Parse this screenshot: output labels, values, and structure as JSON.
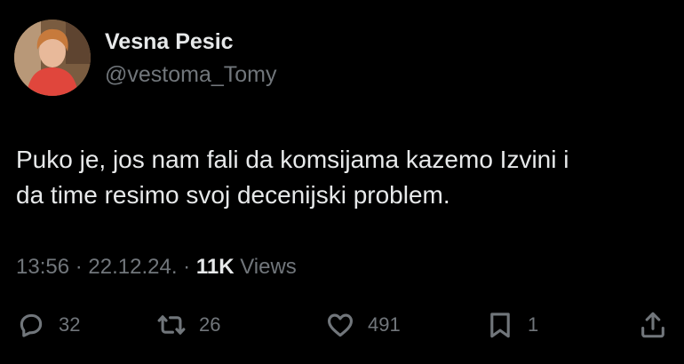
{
  "author": {
    "name": "Vesna Pesic",
    "handle": "@vestoma_Tomy"
  },
  "tweet": {
    "lines": [
      "Puko je, jos nam fali da komsijama kazemo Izvini i",
      "da time resimo svoj decenijski problem."
    ]
  },
  "meta": {
    "time": "13:56",
    "separator": "·",
    "date": "22.12.24.",
    "views_count": "11K",
    "views_label": "Views"
  },
  "actions": {
    "replies": "32",
    "reposts": "26",
    "likes": "491",
    "bookmarks": "1"
  },
  "colors": {
    "background": "#000000",
    "text": "#e7e9ea",
    "secondary": "#71767b"
  },
  "icons": [
    "reply-icon",
    "retweet-icon",
    "like-icon",
    "bookmark-icon",
    "share-icon"
  ]
}
